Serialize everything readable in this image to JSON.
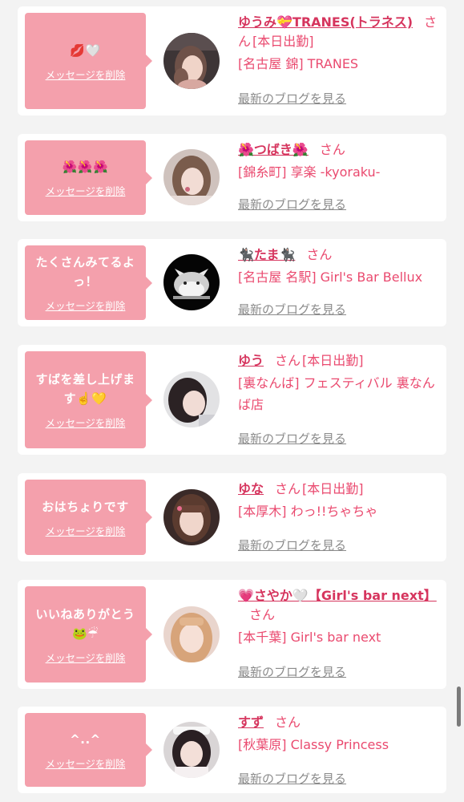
{
  "messages": [
    {
      "message": "💋🤍",
      "delete_label": "メッセージを削除",
      "name": "ゆうみ💝TRANES(トラネス)",
      "san": "さん",
      "status": "[本日出勤]",
      "shop": "[名古屋 錦] TRANES",
      "blog_label": "最新のブログを見る"
    },
    {
      "message": "🌺🌺🌺",
      "delete_label": "メッセージを削除",
      "name": "🌺つばき🌺",
      "san": "さん",
      "status": "",
      "shop": "[錦糸町] 享楽 -kyoraku-",
      "blog_label": "最新のブログを見る"
    },
    {
      "message": "たくさんみてるよっ！",
      "delete_label": "メッセージを削除",
      "name": "🐈‍⬛たま🐈‍⬛",
      "san": "さん",
      "status": "",
      "shop": "[名古屋 名駅] Girl's Bar Bellux",
      "blog_label": "最新のブログを見る"
    },
    {
      "message": "すばを差し上げます☝️💛",
      "delete_label": "メッセージを削除",
      "name": "ゆう",
      "san": "さん",
      "status": "[本日出勤]",
      "shop": "[裏なんば] フェスティバル 裏なんば店",
      "blog_label": "最新のブログを見る"
    },
    {
      "message": "おはちょりです",
      "delete_label": "メッセージを削除",
      "name": "ゆな",
      "san": "さん",
      "status": "[本日出勤]",
      "shop": "[本厚木] わっ!!ちゃちゃ",
      "blog_label": "最新のブログを見る"
    },
    {
      "message": "いいねありがとう🐸☔",
      "delete_label": "メッセージを削除",
      "name": "💗さやか🤍【Girl's bar next】",
      "san": "さん",
      "status": "",
      "shop": "[本千葉] Girl's bar next",
      "blog_label": "最新のブログを見る"
    },
    {
      "message": "^..^",
      "delete_label": "メッセージを削除",
      "name": "すず",
      "san": "さん",
      "status": "",
      "shop": "[秋葉原] Classy Princess",
      "blog_label": "最新のブログを見る"
    }
  ],
  "colors": {
    "bubble": "#f4a0ac",
    "name": "#d6355e",
    "shop": "#ea4a6f",
    "blog": "#8b8b8b",
    "page_bg": "#f3f3f3"
  }
}
